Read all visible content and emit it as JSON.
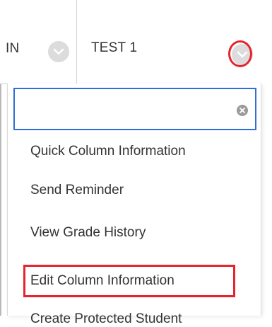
{
  "header": {
    "prev_column_label": "IN",
    "current_column_label": "TEST 1"
  },
  "filter": {
    "value": "",
    "placeholder": ""
  },
  "menu": {
    "items": [
      {
        "label": "Quick Column Information"
      },
      {
        "label": "Send Reminder"
      },
      {
        "label": "View Grade History"
      },
      {
        "label": "Edit Column Information"
      },
      {
        "label": "Create Protected Student"
      }
    ]
  },
  "colors": {
    "highlight": "#e8232e",
    "focus_border": "#2f6fd6",
    "chevron_bg": "#dcdcdc"
  },
  "icons": {
    "column_menu": "chevron-down-icon",
    "clear": "clear-icon"
  }
}
